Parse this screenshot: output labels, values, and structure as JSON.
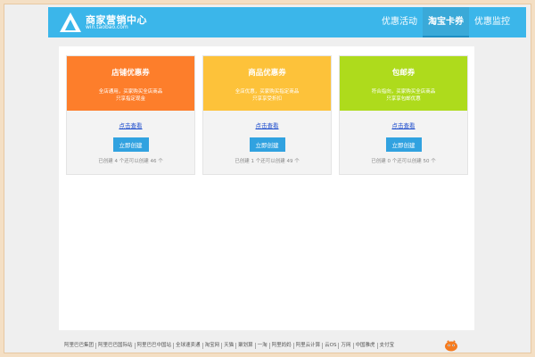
{
  "header": {
    "brand_title": "商家营销中心",
    "brand_sub": "win.taobao.com",
    "nav": [
      {
        "label": "优惠活动",
        "active": false
      },
      {
        "label": "淘宝卡券",
        "active": true
      },
      {
        "label": "优惠监控",
        "active": false
      }
    ]
  },
  "cards": [
    {
      "title": "店铺优惠券",
      "desc_line1": "全店通用，买家购买全店商品",
      "desc_line2": "只享指定现金",
      "link": "点击查看",
      "button": "立即创建",
      "stat": "已创建 4 个还可以创建 46 个",
      "color": "#fd7e2b"
    },
    {
      "title": "商品优惠券",
      "desc_line1": "全店优惠，买家购买指定商品",
      "desc_line2": "只享享受折扣",
      "link": "点击查看",
      "button": "立即创建",
      "stat": "已创建 1 个还可以创建 49 个",
      "color": "#fdc23a"
    },
    {
      "title": "包邮券",
      "desc_line1": "符合指向，买家购买全店商品",
      "desc_line2": "只享享包邮优惠",
      "link": "点击查看",
      "button": "立即创建",
      "stat": "已创建 0 个还可以创建 50 个",
      "color": "#aedb1c"
    }
  ],
  "footer": {
    "links": [
      "阿里巴巴集团",
      "阿里巴巴国际站",
      "阿里巴巴中国站",
      "全球速卖通",
      "淘宝网",
      "天猫",
      "聚划算",
      "一淘",
      "阿里妈妈",
      "阿里云计算",
      "云OS",
      "万网",
      "中国雅虎",
      "支付宝"
    ]
  },
  "icons": {
    "logo": "triangle-logo-icon",
    "mascot": "taobao-mascot-icon"
  }
}
